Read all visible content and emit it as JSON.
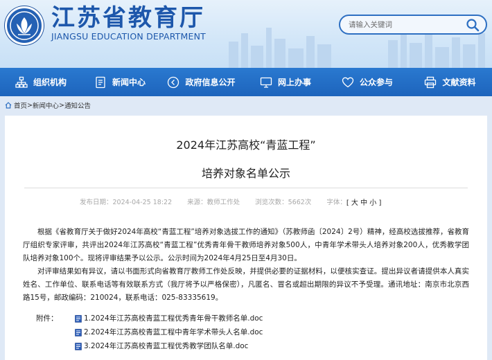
{
  "header": {
    "title": "江苏省教育厅",
    "subtitle": "JIANGSU EDUCATION DEPARTMENT",
    "search_placeholder": "请输入关键词"
  },
  "nav": {
    "items": [
      {
        "label": "组织机构",
        "icon": "org-chart-icon"
      },
      {
        "label": "新闻中心",
        "icon": "document-icon"
      },
      {
        "label": "政府信息公开",
        "icon": "play-circle-icon"
      },
      {
        "label": "网上办事",
        "icon": "monitor-icon"
      },
      {
        "label": "公众参与",
        "icon": "heart-icon"
      },
      {
        "label": "文献资料",
        "icon": "printer-icon"
      }
    ]
  },
  "breadcrumb": {
    "home": "首页",
    "sep": ">",
    "section": "新闻中心",
    "page": "通知公告"
  },
  "article": {
    "title_line1": "2024年江苏高校“青蓝工程”",
    "title_line2": "培养对象名单公示",
    "meta": {
      "date": "发布日期：2024-04-25 18:22",
      "source": "来源：教师工作处",
      "views": "浏览次数：5662次",
      "font_label": "字体：",
      "font_open": "[",
      "font_large": "大",
      "font_medium": "中",
      "font_small": "小",
      "font_close": "]"
    },
    "paragraph1": "根据《省教育厅关于做好2024年高校“青蓝工程”培养对象选拔工作的通知》（苏教师函〔2024〕2号）精神，经高校选拔推荐，省教育厅组织专家评审，共评出2024年江苏高校“青蓝工程”优秀青年骨干教师培养对象500人，中青年学术带头人培养对象200人，优秀教学团队培养对象100个。现将评审结果予以公示。公示时间为2024年4月25日至4月30日。",
    "paragraph2": "对评审结果如有异议，请以书面形式向省教育厅教师工作处反映，并提供必要的证据材料，以便核实查证。提出异议者请提供本人真实姓名、工作单位、联系电话等有效联系方式（我厅将予以严格保密），凡匿名、冒名或超出期限的异议不予受理。通讯地址：南京市北京西路15号，邮政编码：210024，联系电话：025-83335619。",
    "attachments_label": "附件：",
    "attachments": [
      "1.2024年江苏高校青蓝工程优秀青年骨干教师名单.doc",
      "2.2024年江苏高校青蓝工程中青年学术带头人名单.doc",
      "3.2024年江苏高校青蓝工程优秀教学团队名单.doc"
    ]
  },
  "colors": {
    "nav_blue": "#1f68c0",
    "brand_blue": "#1d57ab",
    "page_bg": "#dfe9f6"
  }
}
